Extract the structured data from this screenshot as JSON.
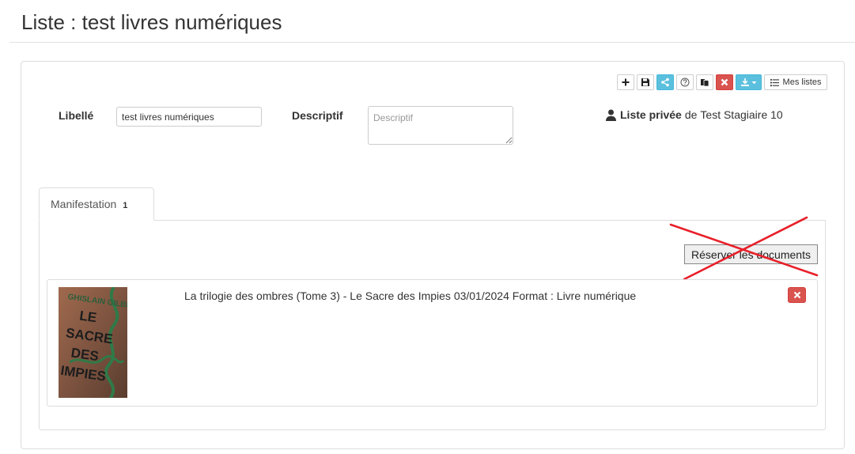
{
  "page": {
    "title": "Liste : test livres numériques"
  },
  "toolbar": {
    "buttons": [
      {
        "name": "add",
        "icon": "plus-icon"
      },
      {
        "name": "save",
        "icon": "save-icon"
      },
      {
        "name": "share",
        "icon": "share-icon",
        "color": "#5bc0de"
      },
      {
        "name": "help",
        "icon": "question-icon"
      },
      {
        "name": "copy",
        "icon": "copy-icon"
      },
      {
        "name": "delete",
        "icon": "close-icon",
        "color": "#d9534f"
      },
      {
        "name": "download",
        "icon": "download-icon",
        "color": "#5bc0de"
      }
    ],
    "mes_listes_label": "Mes listes"
  },
  "form": {
    "libelle_label": "Libellé",
    "libelle_value": "test livres numériques",
    "descriptif_label": "Descriptif",
    "descriptif_placeholder": "Descriptif"
  },
  "owner": {
    "visibility": "Liste privée",
    "prefix": "de",
    "name": "Test Stagiaire 10"
  },
  "tabs": [
    {
      "label": "Manifestation",
      "count": "1"
    }
  ],
  "actions": {
    "reserve_label": "Réserver les documents",
    "reserve_crossed_out": true,
    "cross_color": "#e8202a"
  },
  "items": [
    {
      "title": "La trilogie des ombres (Tome 3) - Le Sacre des Impies 03/01/2024 Format : Livre numérique",
      "cover": {
        "author": "GHISLAIN GILBERTI",
        "title_lines": [
          "LE",
          "SACRE",
          "DES",
          "IMPIES"
        ]
      }
    }
  ],
  "colors": {
    "danger": "#d9534f",
    "info": "#5bc0de",
    "border": "#dddddd"
  }
}
